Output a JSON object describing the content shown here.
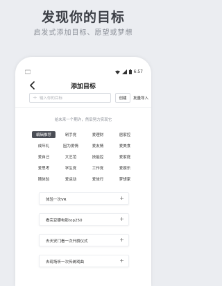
{
  "promo": {
    "headline": "发现你的目标",
    "subline": "启发式添加目标、愿望或梦想"
  },
  "statusbar": {
    "time": "6:57",
    "icons": [
      "signal-icon",
      "battery-icon",
      "wifi-icon"
    ]
  },
  "appbar": {
    "title": "添加目标"
  },
  "search": {
    "placeholder": "输入你的目标",
    "create_label": "创建",
    "import_label": "批量导入"
  },
  "hint": "给未来一个期许，然后努力实现它",
  "tags": [
    {
      "label": "编辑推荐",
      "active": true
    },
    {
      "label": "剁手党",
      "active": false
    },
    {
      "label": "爱理财",
      "active": false
    },
    {
      "label": "居家控",
      "active": false
    },
    {
      "label": "成年礼",
      "active": false
    },
    {
      "label": "因为爱情",
      "active": false
    },
    {
      "label": "爱友情",
      "active": false
    },
    {
      "label": "爱美食",
      "active": false
    },
    {
      "label": "爱自己",
      "active": false
    },
    {
      "label": "文艺范",
      "active": false
    },
    {
      "label": "技能控",
      "active": false
    },
    {
      "label": "爱家庭",
      "active": false
    },
    {
      "label": "爱思考",
      "active": false
    },
    {
      "label": "学生党",
      "active": false
    },
    {
      "label": "工作党",
      "active": false
    },
    {
      "label": "爱娱乐",
      "active": false
    },
    {
      "label": "随体验",
      "active": false
    },
    {
      "label": "爱运动",
      "active": false
    },
    {
      "label": "爱旅行",
      "active": false
    },
    {
      "label": "梦想家",
      "active": false
    }
  ],
  "goals": [
    {
      "label": "体验一次VR"
    },
    {
      "label": "看完豆瓣电影top250"
    },
    {
      "label": "去天安门看一次升旗仪式"
    },
    {
      "label": "去现场听一次传统戏曲"
    }
  ],
  "colors": {
    "background": "#ebedf1",
    "active_tag": "#4a4d55"
  }
}
